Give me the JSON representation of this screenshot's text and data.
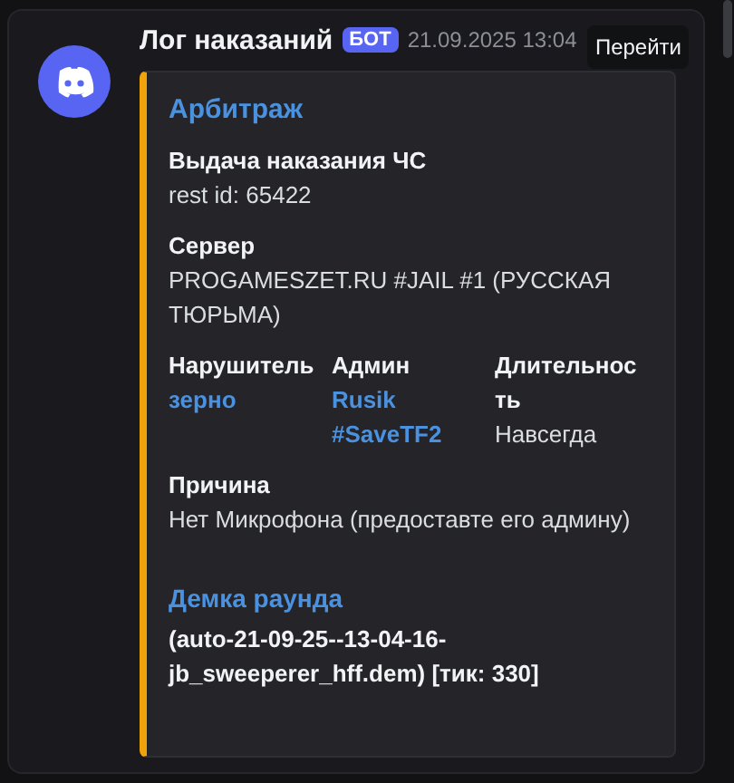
{
  "message": {
    "author": "Лог наказаний",
    "badge": "БОТ",
    "timestamp": "21.09.2025 13:04",
    "jump_button": "Перейти",
    "embed": {
      "title": "Арбитраж",
      "fields": [
        {
          "name": "Выдача наказания ЧС",
          "value": "rest id: 65422",
          "inline": false,
          "kind": "text"
        },
        {
          "name": "Сервер",
          "value": "PROGAMESZET.RU #JAIL #1 (РУССКАЯ ТЮРЬМА)",
          "inline": false,
          "kind": "text"
        },
        {
          "name": "Нарушитель",
          "value": "зерно",
          "inline": true,
          "kind": "mention"
        },
        {
          "name": "Админ",
          "value": "Rusik #SaveTF2",
          "inline": true,
          "kind": "mention"
        },
        {
          "name": "Длительность",
          "value": "Навсегда",
          "inline": true,
          "kind": "text"
        },
        {
          "name": "Причина",
          "value": "Нет Микрофона (предоставте его админу)",
          "inline": false,
          "kind": "text"
        },
        {
          "name": "Демка раунда",
          "value": "(auto-21-09-25--13-04-16-jb_sweeperer_hff.dem) [тик: 330]",
          "inline": false,
          "kind": "demo"
        }
      ]
    }
  }
}
